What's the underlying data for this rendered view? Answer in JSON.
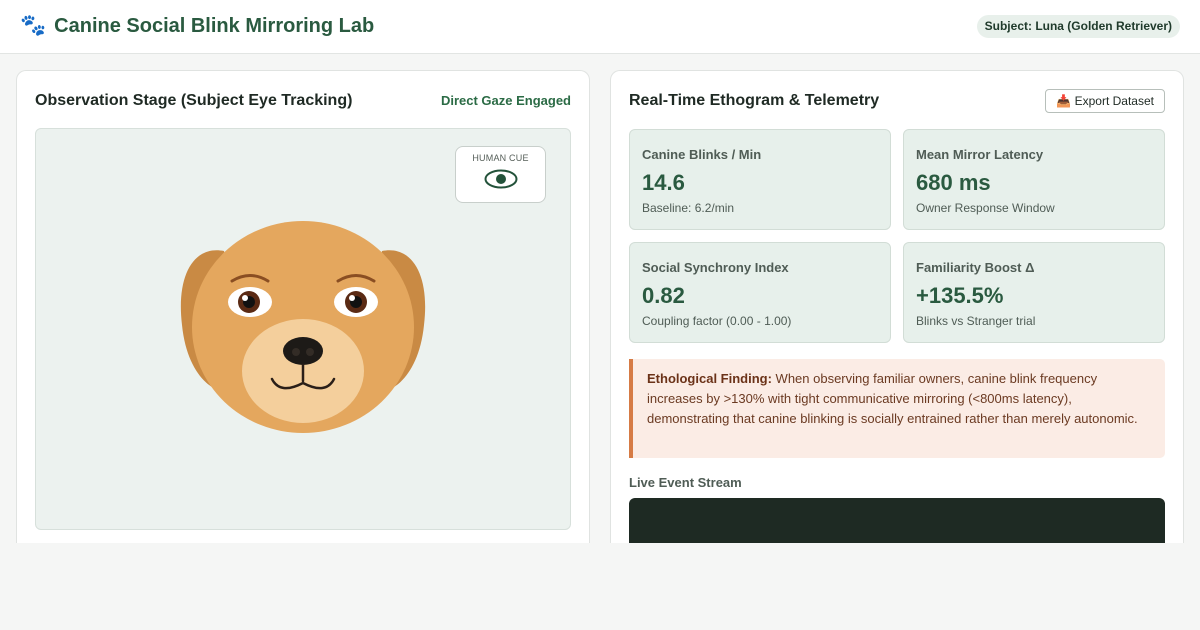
{
  "header": {
    "app_icon": "paw-icon",
    "title": "Canine Social Blink Mirroring Lab",
    "subject_badge": "Subject: Luna (Golden Retriever)"
  },
  "observation": {
    "title": "Observation Stage (Subject Eye Tracking)",
    "gaze_status": "Direct Gaze Engaged",
    "human_cue_label": "HUMAN CUE",
    "cue_icon": "eye-icon"
  },
  "telemetry": {
    "title": "Real-Time Ethogram & Telemetry",
    "export_icon": "inbox-tray-icon",
    "export_label": "📥 Export Dataset",
    "metrics": [
      {
        "label": "Canine Blinks / Min",
        "value": "14.6",
        "sub": "Baseline: 6.2/min"
      },
      {
        "label": "Mean Mirror Latency",
        "value": "680 ms",
        "sub": "Owner Response Window"
      },
      {
        "label": "Social Synchrony Index",
        "value": "0.82",
        "sub": "Coupling factor (0.00 - 1.00)"
      },
      {
        "label": "Familiarity Boost Δ",
        "value": "+135.5%",
        "sub": "Blinks vs Stranger trial"
      }
    ],
    "finding_label": "Ethological Finding:",
    "finding_text": " When observing familiar owners, canine blink frequency increases by >130% with tight communicative mirroring (<800ms latency), demonstrating that canine blinking is socially entrained rather than merely autonomic.",
    "stream_label": "Live Event Stream"
  },
  "colors": {
    "accent": "#2a5a40",
    "finding_border": "#d67b45",
    "dog_fur": "#e4a75e",
    "stream_bg": "#1e2a23"
  }
}
